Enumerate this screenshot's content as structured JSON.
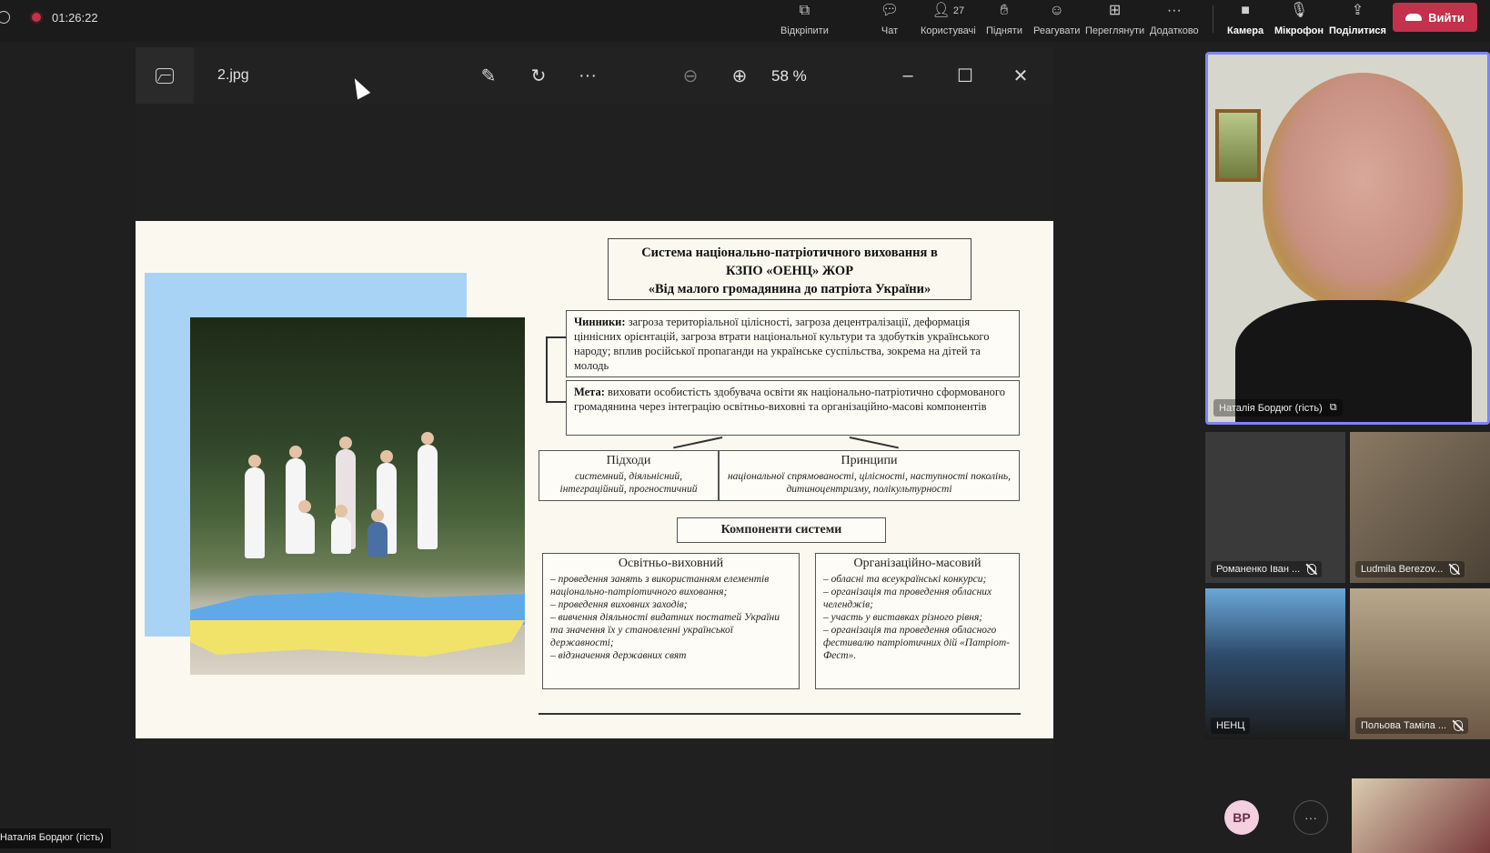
{
  "recording": {
    "time": "01:26:22"
  },
  "toolbar": {
    "items": [
      {
        "label": "Відкріпити",
        "icon": "unpin-icon"
      },
      {
        "label": "Чат",
        "icon": "chat-icon"
      },
      {
        "label": "Користувачі",
        "icon": "people-icon",
        "count": "27"
      },
      {
        "label": "Підняти",
        "icon": "raise-hand-icon"
      },
      {
        "label": "Реагувати",
        "icon": "react-icon"
      },
      {
        "label": "Переглянути",
        "icon": "view-icon"
      },
      {
        "label": "Додатково",
        "icon": "more-icon"
      },
      {
        "label": "Камера",
        "icon": "camera-icon"
      },
      {
        "label": "Мікрофон",
        "icon": "mic-off-icon"
      },
      {
        "label": "Поділитися",
        "icon": "share-icon"
      }
    ],
    "leave_label": "Вийти"
  },
  "viewer": {
    "filename": "2.jpg",
    "zoom": "58 %"
  },
  "slide": {
    "title_lines": [
      "Система національно-патріотичного виховання в",
      "КЗПО «ОЕНЦ» ЖОР",
      "«Від малого громадянина до патріота України»"
    ],
    "factors_label": "Чинники:",
    "factors_text": " загроза територіальної цілісності, загроза децентралізації, деформація ціннісних орієнтацій, загроза втрати національної культури та здобутків українського народу; вплив російської пропаганди на українське суспільства, зокрема на дітей та молодь",
    "goal_label": "Мета:",
    "goal_text": " виховати особистість здобувача освіти як національно-патріотично сформованого громадянина через інтеграцію освітньо-виховні та організаційно-масові компонентів",
    "approaches_title": "Підходи",
    "approaches_text": "системний, діяльнісний, інтеграційний, прогностичний",
    "principles_title": "Принципи",
    "principles_text": "національної спрямованості, цілісності, наступності поколінь, дитиноцентризму, полікультурності",
    "components_title": "Компоненти системи",
    "edu_title": "Освітньо-виховний",
    "edu_items": [
      "– проведення занять з використанням елементів національно-патріотичного виховання;",
      "– проведення виховних заходів;",
      "– вивчення діяльності видатних постатей України та значення їх у становленні української державності;",
      "– відзначення державних свят"
    ],
    "org_title": "Організаційно-масовий",
    "org_items": [
      "– обласні та всеукраїнські конкурси;",
      "– організація та проведення обласних челенджів;",
      "– участь у виставках різного рівня;",
      "– організація та проведення обласного фестивалю патріотичних дій «Патріот-Фест»."
    ]
  },
  "participants": {
    "main": "Наталія Бордюг (гість)",
    "tiles": [
      "Романенко Іван ...",
      "Ludmila Berezov...",
      "НЕНЦ",
      "Польова Таміла ..."
    ],
    "avatar_initials": "ВР",
    "more_label": "···",
    "presenter_label": "Наталія Бордюг (гість)"
  }
}
